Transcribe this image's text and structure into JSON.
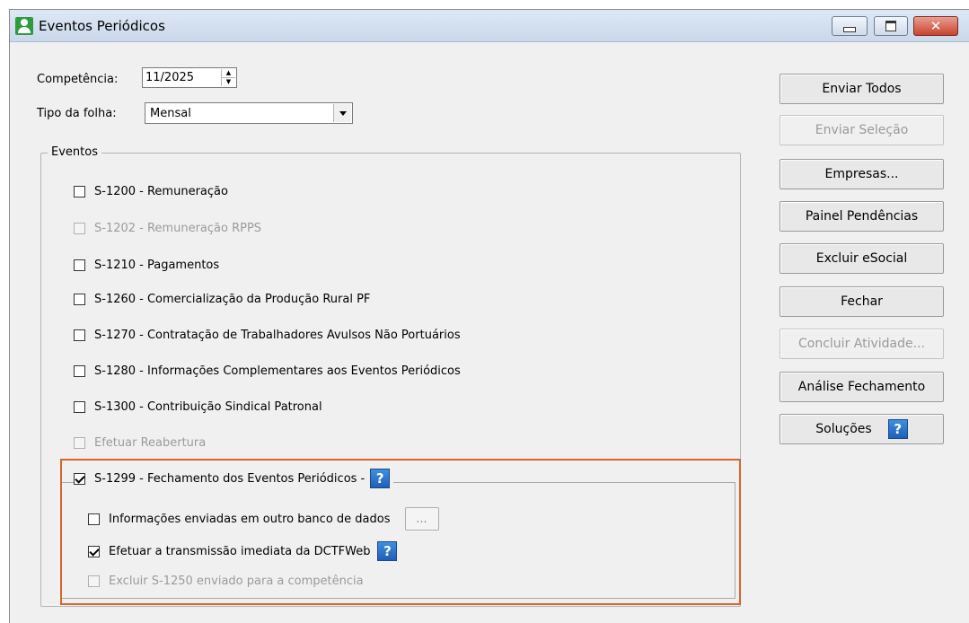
{
  "window": {
    "title": "Eventos Periódicos",
    "icon": "user-icon",
    "controls": [
      "minimize-icon",
      "maximize-icon",
      "close-icon"
    ],
    "colors": {
      "titlebar": "#c9d8ea",
      "close_button": "#c9442e",
      "highlight": "#d4662f",
      "help_icon": "#1f5fb8"
    }
  },
  "form": {
    "competencia": {
      "label": "Competência:",
      "value": "11/2025"
    },
    "tipo_folha": {
      "label": "Tipo da folha:",
      "value": "Mensal"
    }
  },
  "eventos": {
    "legend": "Eventos",
    "items": [
      {
        "label": "S-1200 - Remuneração",
        "checked": false,
        "enabled": true
      },
      {
        "label": "S-1202 - Remuneração RPPS",
        "checked": false,
        "enabled": false
      },
      {
        "label": "S-1210 - Pagamentos",
        "checked": false,
        "enabled": true
      },
      {
        "label": "S-1260 - Comercialização da Produção Rural PF",
        "checked": false,
        "enabled": true
      },
      {
        "label": "S-1270 - Contratação de Trabalhadores Avulsos Não Portuários",
        "checked": false,
        "enabled": true
      },
      {
        "label": "S-1280 - Informações Complementares aos Eventos Periódicos",
        "checked": false,
        "enabled": true
      },
      {
        "label": "S-1300 - Contribuição Sindical Patronal",
        "checked": false,
        "enabled": true
      },
      {
        "label": "Efetuar Reabertura",
        "checked": false,
        "enabled": false
      }
    ],
    "fechamento": {
      "label": "S-1299 - Fechamento dos Eventos Periódicos -",
      "checked": true,
      "help": "?",
      "options": [
        {
          "label": "Informações enviadas em outro banco de dados",
          "checked": false,
          "enabled": true,
          "button": "..."
        },
        {
          "label": "Efetuar a transmissão imediata da DCTFWeb",
          "checked": true,
          "enabled": true,
          "help": "?"
        },
        {
          "label": "Excluir S-1250 enviado para a competência",
          "checked": false,
          "enabled": false
        }
      ]
    }
  },
  "buttons": {
    "enviar_todos": "Enviar Todos",
    "enviar_selecao": "Enviar Seleção",
    "empresas": "Empresas...",
    "painel_pendencias": "Painel Pendências",
    "excluir_esocial": "Excluir eSocial",
    "fechar": "Fechar",
    "concluir_atividade": "Concluir Atividade...",
    "analise_fechamento": "Análise Fechamento",
    "solucoes": "Soluções",
    "solucoes_help": "?"
  }
}
